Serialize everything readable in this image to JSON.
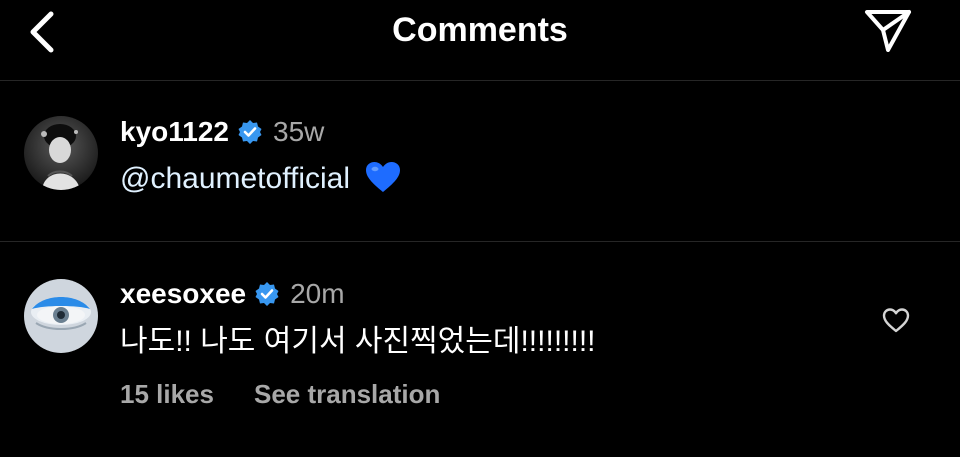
{
  "header": {
    "title": "Comments",
    "back_icon": "chevron-left-icon",
    "share_icon": "paper-plane-icon"
  },
  "colors": {
    "background": "#000000",
    "verified": "#3897f0",
    "secondary_text": "#a8a8a8",
    "heart_emoji": "#1e6cff"
  },
  "comments": [
    {
      "username": "kyo1122",
      "verified": true,
      "time": "35w",
      "mention": "@chaumetofficial",
      "emoji": "blue-heart-icon"
    },
    {
      "username": "xeesoxee",
      "verified": true,
      "time": "20m",
      "text": "나도!! 나도 여기서 사진찍었는데!!!!!!!!!",
      "likes": "15 likes",
      "translate": "See translation"
    }
  ]
}
